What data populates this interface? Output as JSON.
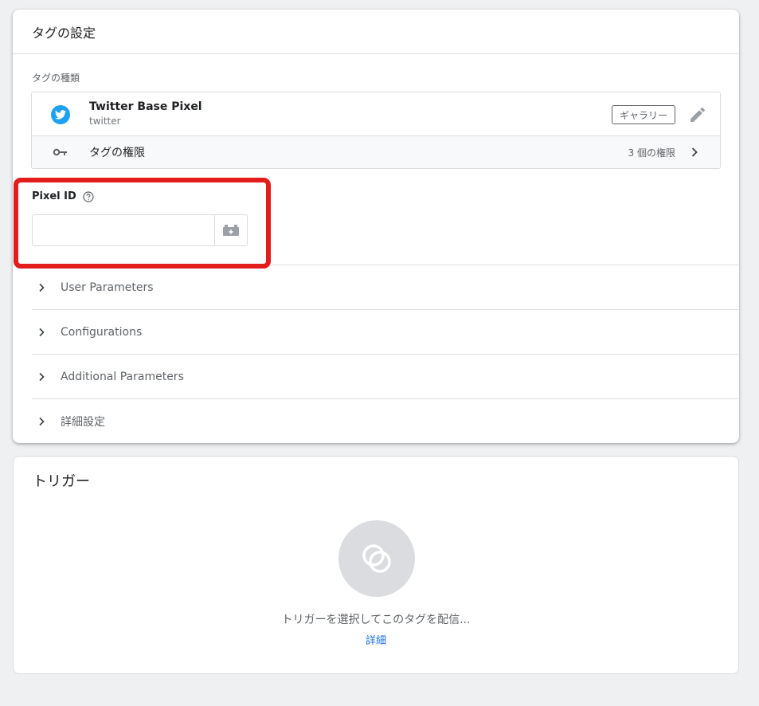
{
  "tag_config": {
    "header_title": "タグの設定",
    "tag_type_label": "タグの種類",
    "tag": {
      "name": "Twitter Base Pixel",
      "vendor": "twitter",
      "gallery_label": "ギャラリー",
      "permissions_label": "タグの権限",
      "permissions_count": "3 個の権限"
    },
    "pixel_id": {
      "label": "Pixel ID",
      "value": "",
      "placeholder": ""
    },
    "sections": [
      {
        "label": "User Parameters"
      },
      {
        "label": "Configurations"
      },
      {
        "label": "Additional Parameters"
      },
      {
        "label": "詳細設定"
      }
    ]
  },
  "triggers": {
    "title": "トリガー",
    "empty_text": "トリガーを選択してこのタグを配信...",
    "link_label": "詳細"
  },
  "colors": {
    "twitter_blue": "#1da1f2",
    "highlight_red": "#e31c1c",
    "link_blue": "#1a73e8"
  },
  "icons": [
    "twitter-icon",
    "edit-pencil-icon",
    "key-icon",
    "chevron-right-icon",
    "help-circle-icon",
    "variable-brick-icon",
    "trigger-circles-icon"
  ]
}
